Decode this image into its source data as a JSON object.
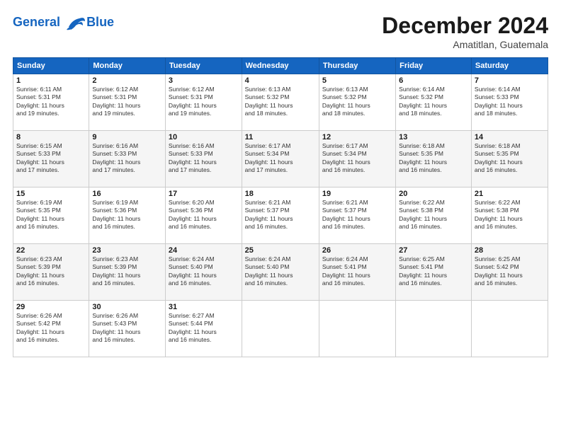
{
  "logo": {
    "line1": "General",
    "line2": "Blue"
  },
  "title": "December 2024",
  "location": "Amatitlan, Guatemala",
  "days_of_week": [
    "Sunday",
    "Monday",
    "Tuesday",
    "Wednesday",
    "Thursday",
    "Friday",
    "Saturday"
  ],
  "weeks": [
    [
      {
        "day": "1",
        "info": "Sunrise: 6:11 AM\nSunset: 5:31 PM\nDaylight: 11 hours\nand 19 minutes."
      },
      {
        "day": "2",
        "info": "Sunrise: 6:12 AM\nSunset: 5:31 PM\nDaylight: 11 hours\nand 19 minutes."
      },
      {
        "day": "3",
        "info": "Sunrise: 6:12 AM\nSunset: 5:31 PM\nDaylight: 11 hours\nand 19 minutes."
      },
      {
        "day": "4",
        "info": "Sunrise: 6:13 AM\nSunset: 5:32 PM\nDaylight: 11 hours\nand 18 minutes."
      },
      {
        "day": "5",
        "info": "Sunrise: 6:13 AM\nSunset: 5:32 PM\nDaylight: 11 hours\nand 18 minutes."
      },
      {
        "day": "6",
        "info": "Sunrise: 6:14 AM\nSunset: 5:32 PM\nDaylight: 11 hours\nand 18 minutes."
      },
      {
        "day": "7",
        "info": "Sunrise: 6:14 AM\nSunset: 5:33 PM\nDaylight: 11 hours\nand 18 minutes."
      }
    ],
    [
      {
        "day": "8",
        "info": "Sunrise: 6:15 AM\nSunset: 5:33 PM\nDaylight: 11 hours\nand 17 minutes."
      },
      {
        "day": "9",
        "info": "Sunrise: 6:16 AM\nSunset: 5:33 PM\nDaylight: 11 hours\nand 17 minutes."
      },
      {
        "day": "10",
        "info": "Sunrise: 6:16 AM\nSunset: 5:33 PM\nDaylight: 11 hours\nand 17 minutes."
      },
      {
        "day": "11",
        "info": "Sunrise: 6:17 AM\nSunset: 5:34 PM\nDaylight: 11 hours\nand 17 minutes."
      },
      {
        "day": "12",
        "info": "Sunrise: 6:17 AM\nSunset: 5:34 PM\nDaylight: 11 hours\nand 16 minutes."
      },
      {
        "day": "13",
        "info": "Sunrise: 6:18 AM\nSunset: 5:35 PM\nDaylight: 11 hours\nand 16 minutes."
      },
      {
        "day": "14",
        "info": "Sunrise: 6:18 AM\nSunset: 5:35 PM\nDaylight: 11 hours\nand 16 minutes."
      }
    ],
    [
      {
        "day": "15",
        "info": "Sunrise: 6:19 AM\nSunset: 5:35 PM\nDaylight: 11 hours\nand 16 minutes."
      },
      {
        "day": "16",
        "info": "Sunrise: 6:19 AM\nSunset: 5:36 PM\nDaylight: 11 hours\nand 16 minutes."
      },
      {
        "day": "17",
        "info": "Sunrise: 6:20 AM\nSunset: 5:36 PM\nDaylight: 11 hours\nand 16 minutes."
      },
      {
        "day": "18",
        "info": "Sunrise: 6:21 AM\nSunset: 5:37 PM\nDaylight: 11 hours\nand 16 minutes."
      },
      {
        "day": "19",
        "info": "Sunrise: 6:21 AM\nSunset: 5:37 PM\nDaylight: 11 hours\nand 16 minutes."
      },
      {
        "day": "20",
        "info": "Sunrise: 6:22 AM\nSunset: 5:38 PM\nDaylight: 11 hours\nand 16 minutes."
      },
      {
        "day": "21",
        "info": "Sunrise: 6:22 AM\nSunset: 5:38 PM\nDaylight: 11 hours\nand 16 minutes."
      }
    ],
    [
      {
        "day": "22",
        "info": "Sunrise: 6:23 AM\nSunset: 5:39 PM\nDaylight: 11 hours\nand 16 minutes."
      },
      {
        "day": "23",
        "info": "Sunrise: 6:23 AM\nSunset: 5:39 PM\nDaylight: 11 hours\nand 16 minutes."
      },
      {
        "day": "24",
        "info": "Sunrise: 6:24 AM\nSunset: 5:40 PM\nDaylight: 11 hours\nand 16 minutes."
      },
      {
        "day": "25",
        "info": "Sunrise: 6:24 AM\nSunset: 5:40 PM\nDaylight: 11 hours\nand 16 minutes."
      },
      {
        "day": "26",
        "info": "Sunrise: 6:24 AM\nSunset: 5:41 PM\nDaylight: 11 hours\nand 16 minutes."
      },
      {
        "day": "27",
        "info": "Sunrise: 6:25 AM\nSunset: 5:41 PM\nDaylight: 11 hours\nand 16 minutes."
      },
      {
        "day": "28",
        "info": "Sunrise: 6:25 AM\nSunset: 5:42 PM\nDaylight: 11 hours\nand 16 minutes."
      }
    ],
    [
      {
        "day": "29",
        "info": "Sunrise: 6:26 AM\nSunset: 5:42 PM\nDaylight: 11 hours\nand 16 minutes."
      },
      {
        "day": "30",
        "info": "Sunrise: 6:26 AM\nSunset: 5:43 PM\nDaylight: 11 hours\nand 16 minutes."
      },
      {
        "day": "31",
        "info": "Sunrise: 6:27 AM\nSunset: 5:44 PM\nDaylight: 11 hours\nand 16 minutes."
      },
      null,
      null,
      null,
      null
    ]
  ]
}
